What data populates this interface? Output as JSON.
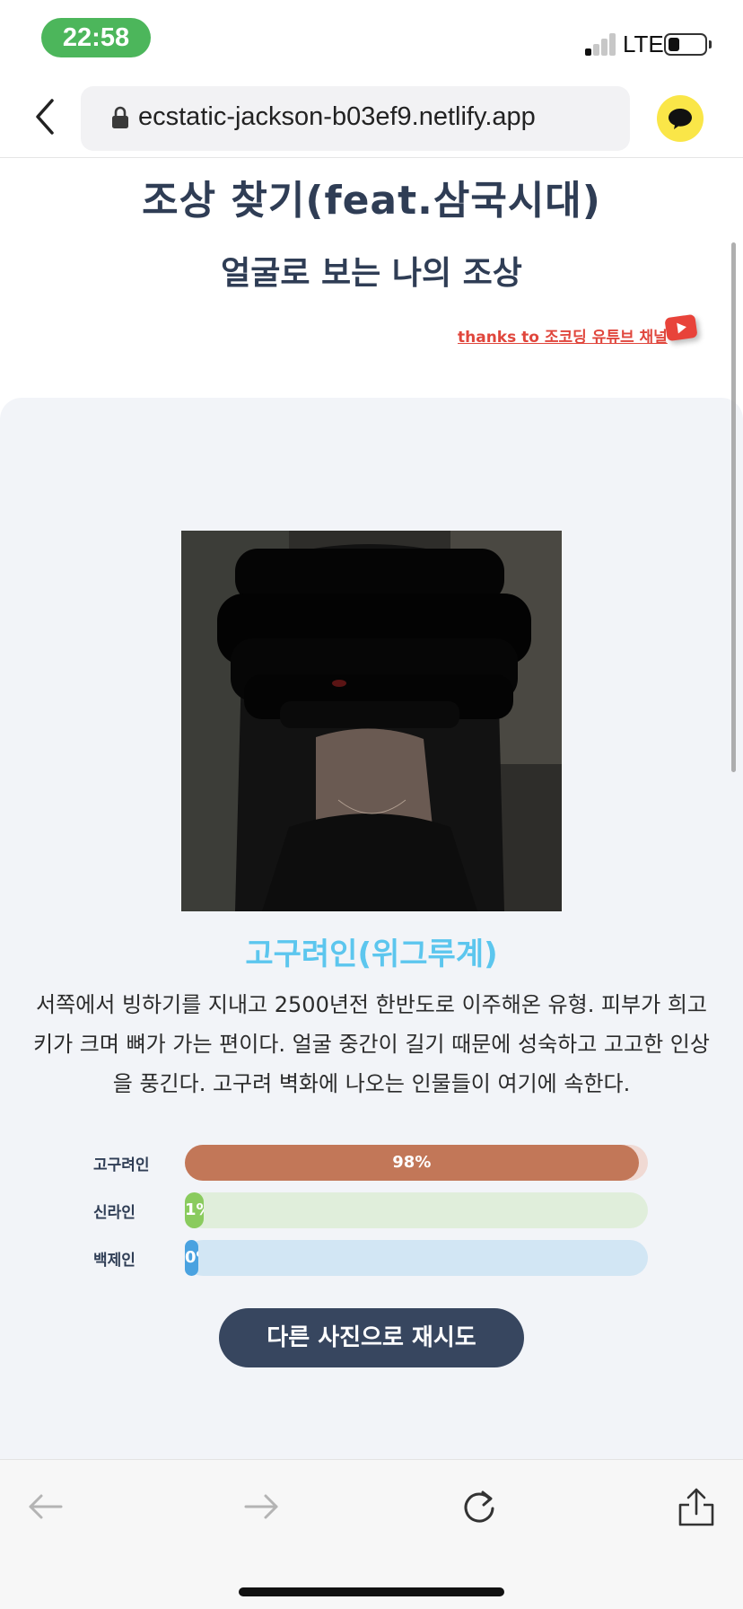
{
  "status_bar": {
    "time": "22:58",
    "network": "LTE",
    "time_pill_color": "#4cb65b",
    "battery_level_percent": 30
  },
  "browser": {
    "url": "ecstatic-jackson-b03ef9.netlify.app",
    "chat_button_color": "#fae648",
    "icons": [
      "back-chevron-icon",
      "lock-icon",
      "chat-bubble-icon",
      "back-arrow-icon",
      "forward-arrow-icon",
      "reload-icon",
      "share-icon"
    ]
  },
  "page": {
    "title": "조상 찾기(feat.삼국시대)",
    "subtitle": "얼굴로 보는 나의 조상",
    "thanks_link": "thanks to 조코딩 유튜브 채널"
  },
  "result": {
    "type": "고구려인(위그루계)",
    "description": "서쪽에서 빙하기를 지내고 2500년전 한반도로 이주해온 유형. 피부가 희고 키가 크며 뼈가 가는 편이다. 얼굴 중간이 길기 때문에 성숙하고 고고한 인상을 풍긴다. 고구려 벽화에 나오는 인물들이 여기에 속한다.",
    "bars": [
      {
        "label": "고구려인",
        "percent": 98,
        "text": "98%",
        "fill_color": "#c27758",
        "track_color": "#f0d9d3"
      },
      {
        "label": "신라인",
        "percent": 4,
        "text": "1%",
        "fill_color": "#8acb5e",
        "track_color": "#e0eedb"
      },
      {
        "label": "백제인",
        "percent": 2,
        "text": "0%",
        "fill_color": "#4aa2e0",
        "track_color": "#d2e6f4"
      }
    ],
    "retry_button": "다른 사진으로 재시도"
  }
}
